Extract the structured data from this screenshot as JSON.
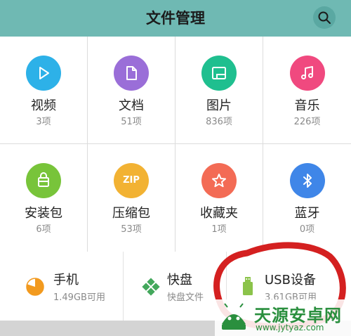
{
  "header": {
    "title": "文件管理",
    "search_icon": "search-icon"
  },
  "colors": {
    "header_bg": "#6fb9b3",
    "video": "#2db1e8",
    "docs": "#9a6ed8",
    "images": "#1fbf8f",
    "music": "#f0497f",
    "apk": "#78c43a",
    "zip": "#f2b233",
    "favorites": "#f36b55",
    "bluetooth": "#3f86e8",
    "phone_pie": "#f29a1f",
    "kuaipan": "#43a85c",
    "usb": "#8bc34a",
    "annotation": "#d42020"
  },
  "categories": [
    {
      "label": "视频",
      "count": "3项",
      "icon": "play-icon"
    },
    {
      "label": "文档",
      "count": "51项",
      "icon": "document-icon"
    },
    {
      "label": "图片",
      "count": "836项",
      "icon": "image-icon"
    },
    {
      "label": "音乐",
      "count": "226项",
      "icon": "music-note-icon"
    },
    {
      "label": "安装包",
      "count": "6项",
      "icon": "package-icon"
    },
    {
      "label": "压缩包",
      "count": "53项",
      "icon": "zip-icon",
      "badge": "ZIP"
    },
    {
      "label": "收藏夹",
      "count": "1项",
      "icon": "star-icon"
    },
    {
      "label": "蓝牙",
      "count": "0项",
      "icon": "bluetooth-icon"
    }
  ],
  "storage": [
    {
      "name": "手机",
      "sub": "1.49GB可用",
      "icon": "pie-chart-icon"
    },
    {
      "name": "快盘",
      "sub": "快盘文件",
      "icon": "kuaipan-icon"
    },
    {
      "name": "USB设备",
      "sub": "3.61GB可用",
      "icon": "usb-drive-icon"
    }
  ],
  "watermark": {
    "name": "天源安卓网",
    "url": "www.jytyaz.com"
  }
}
